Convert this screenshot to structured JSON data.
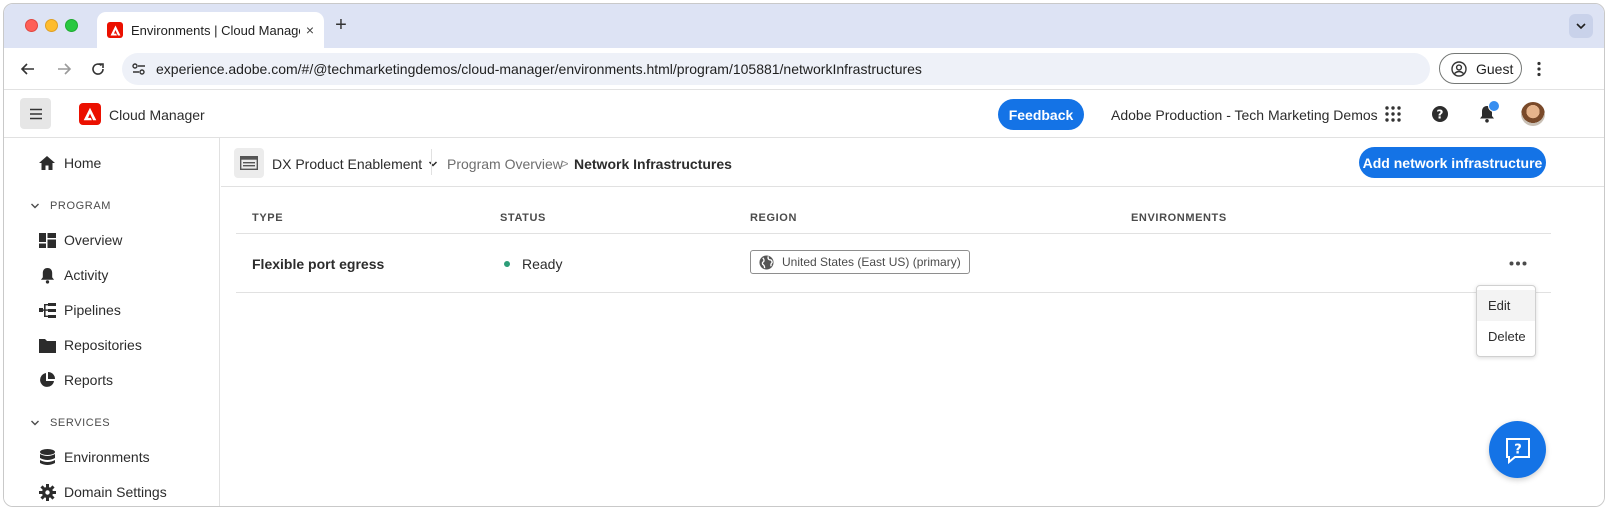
{
  "browser": {
    "tab_title": "Environments | Cloud Manage",
    "url": "experience.adobe.com/#/@techmarketingdemos/cloud-manager/environments.html/program/105881/networkInfrastructures",
    "profile_label": "Guest"
  },
  "header": {
    "app_name": "Cloud Manager",
    "feedback_label": "Feedback",
    "org_name": "Adobe Production - Tech Marketing Demos"
  },
  "sidebar": {
    "home_label": "Home",
    "program_section": "PROGRAM",
    "program_items": [
      {
        "label": "Overview",
        "icon": "dashboard-icon"
      },
      {
        "label": "Activity",
        "icon": "bell-icon"
      },
      {
        "label": "Pipelines",
        "icon": "pipeline-icon"
      },
      {
        "label": "Repositories",
        "icon": "folder-icon"
      },
      {
        "label": "Reports",
        "icon": "pie-chart-icon"
      }
    ],
    "services_section": "SERVICES",
    "services_items": [
      {
        "label": "Environments",
        "icon": "database-icon"
      },
      {
        "label": "Domain Settings",
        "icon": "gear-icon"
      }
    ]
  },
  "breadcrumb": {
    "program_name": "DX Product Enablement",
    "overview": "Program Overview",
    "separator": ">",
    "current": "Network Infrastructures"
  },
  "actions": {
    "add_label": "Add network infrastructure"
  },
  "table": {
    "columns": [
      "TYPE",
      "STATUS",
      "REGION",
      "ENVIRONMENTS"
    ],
    "rows": [
      {
        "type": "Flexible port egress",
        "status": "Ready",
        "region": "United States (East US) (primary)",
        "environments": ""
      }
    ]
  },
  "row_menu": {
    "items": [
      "Edit",
      "Delete"
    ]
  },
  "colors": {
    "accent": "#1473e6",
    "adobe_red": "#eb1000",
    "status_ready": "#2d9d78"
  }
}
